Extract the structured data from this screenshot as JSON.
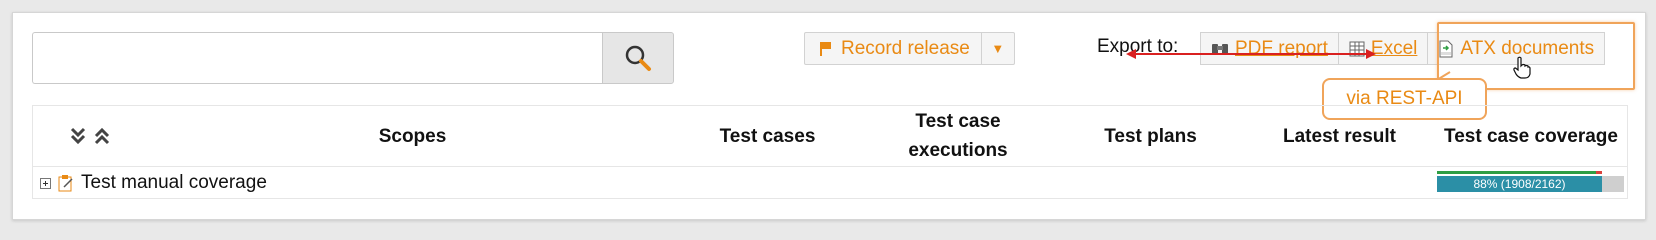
{
  "search": {
    "placeholder": "",
    "value": ""
  },
  "toolbar": {
    "record_release_label": "Record release",
    "export_label": "Export to:",
    "export_buttons": [
      {
        "label": "PDF report",
        "icon": "binoculars-icon"
      },
      {
        "label": "Excel",
        "icon": "spreadsheet-icon"
      },
      {
        "label": "ATX documents",
        "icon": "xml-document-icon"
      }
    ]
  },
  "annotation": {
    "callout": "via REST-API"
  },
  "table": {
    "columns": [
      "Scopes",
      "Test cases",
      "Test case executions",
      "Test plans",
      "Latest result",
      "Test case coverage"
    ],
    "rows": [
      {
        "label": "Test manual coverage",
        "coverage_text": "88% (1908/2162)",
        "coverage_percent": 88
      }
    ]
  },
  "colors": {
    "accent": "#e98a14",
    "coverage_bar": "#2b8fa6",
    "highlight": "#f0a45a",
    "arrow": "#d92020"
  }
}
